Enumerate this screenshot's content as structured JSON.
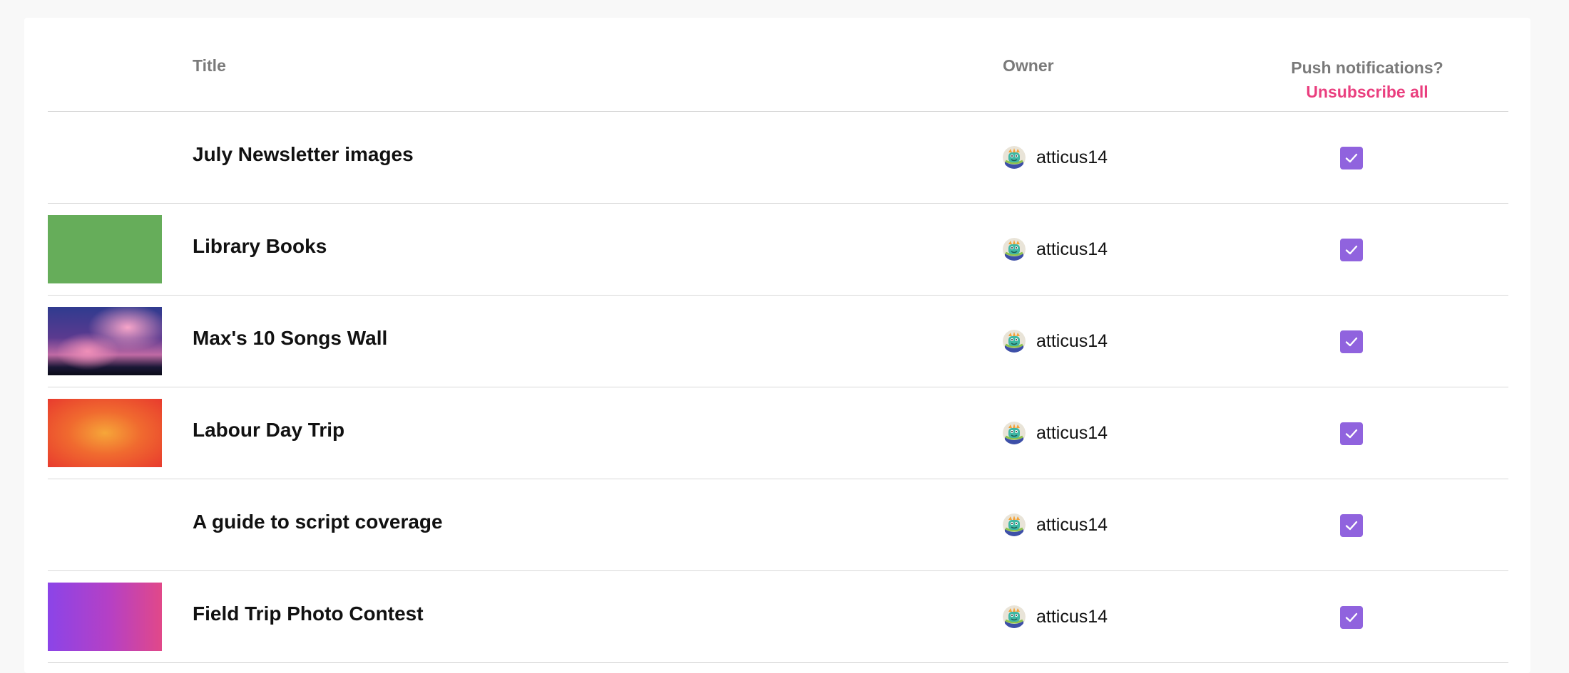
{
  "header": {
    "title_label": "Title",
    "owner_label": "Owner",
    "push_label": "Push notifications?",
    "unsubscribe_label": "Unsubscribe all"
  },
  "colors": {
    "accent_pink": "#ea3f7f",
    "checkbox_purple": "#9063de",
    "header_gray": "#7a7a7a",
    "divider": "#d8d8d8"
  },
  "rows": [
    {
      "title": "July Newsletter images",
      "owner": "atticus14",
      "thumbnail": "none",
      "subscribed": true
    },
    {
      "title": "Library Books",
      "owner": "atticus14",
      "thumbnail": "green",
      "subscribed": true
    },
    {
      "title": "Max's 10 Songs Wall",
      "owner": "atticus14",
      "thumbnail": "photo",
      "subscribed": true
    },
    {
      "title": "Labour Day Trip",
      "owner": "atticus14",
      "thumbnail": "orange-gradient",
      "subscribed": true
    },
    {
      "title": "A guide to script coverage",
      "owner": "atticus14",
      "thumbnail": "none",
      "subscribed": true
    },
    {
      "title": "Field Trip Photo Contest",
      "owner": "atticus14",
      "thumbnail": "purple-gradient",
      "subscribed": true
    }
  ],
  "icons": {
    "avatar": "monster-avatar-icon",
    "check": "checkmark-icon"
  }
}
